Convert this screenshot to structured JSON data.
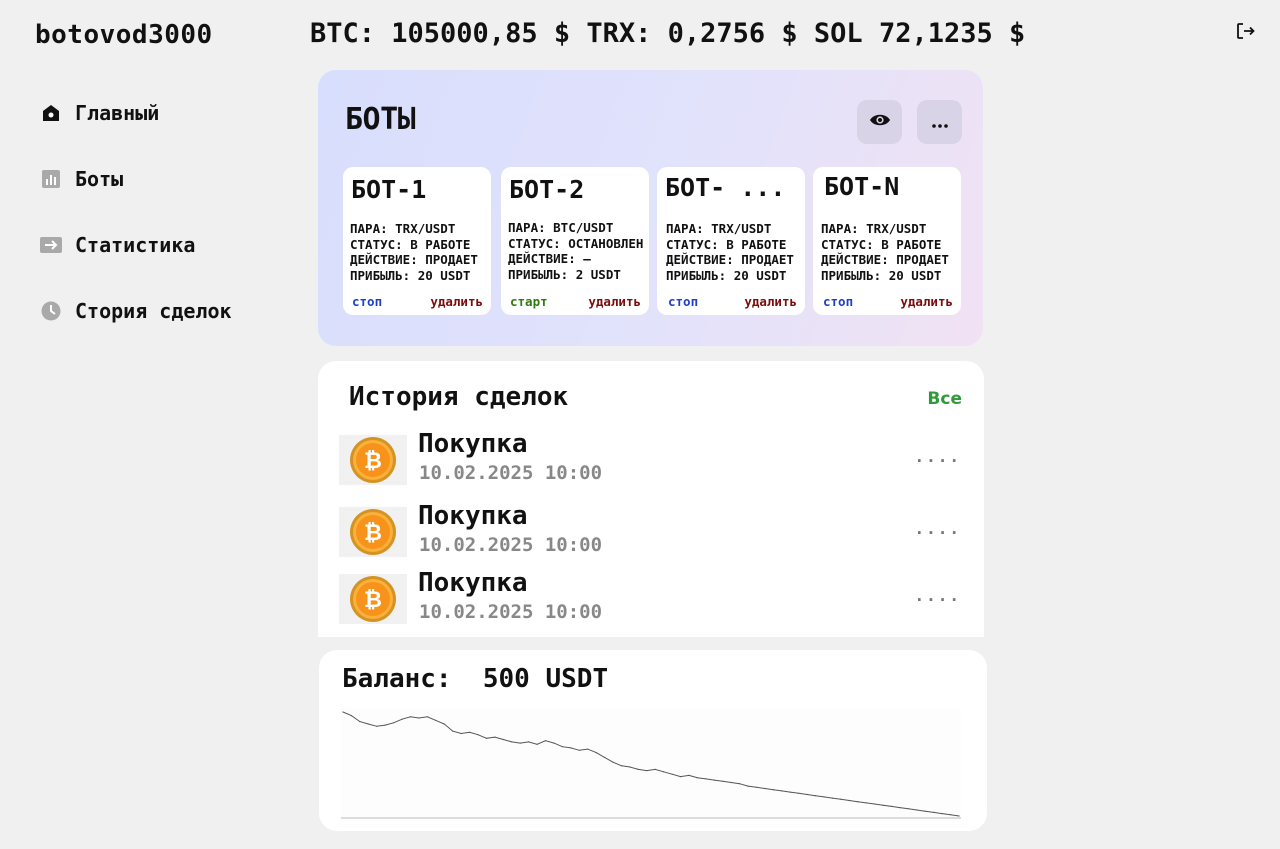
{
  "app": {
    "logo": "botovod3000"
  },
  "ticker": {
    "text": "BTC: 105000,85 $ TRX: 0,2756 $ SOL 72,1235 $"
  },
  "sidebar": {
    "items": [
      {
        "label": "Главный",
        "icon": "home-icon"
      },
      {
        "label": "Боты",
        "icon": "bar-chart-icon"
      },
      {
        "label": "Статистика",
        "icon": "arrow-right-icon"
      },
      {
        "label": "Стория сделок",
        "icon": "clock-icon"
      }
    ]
  },
  "bots": {
    "title": "БОТЫ",
    "cards": [
      {
        "name": "БОТ-1",
        "pair": "ПАРА: TRX/USDT",
        "status": "СТАТУС: В РАБОТЕ",
        "action": "ДЕЙСТВИЕ: ПРОДАЕТ",
        "profit": "ПРИБЫЛЬ: 20 USDT",
        "toggle": "стоп",
        "delete": "удалить"
      },
      {
        "name": "БОТ-2",
        "pair": "ПАРА: BTC/USDT",
        "status": "СТАТУС: ОСТАНОВЛЕН",
        "action": "ДЕЙСТВИЕ: –",
        "profit": "ПРИБЫЛЬ: 2 USDT",
        "toggle": "старт",
        "delete": "удалить"
      },
      {
        "name": "БОТ- ...",
        "pair": "ПАРА: TRX/USDT",
        "status": "СТАТУС: В РАБОТЕ",
        "action": "ДЕЙСТВИЕ: ПРОДАЕТ",
        "profit": "ПРИБЫЛЬ: 20 USDT",
        "toggle": "стоп",
        "delete": "удалить"
      },
      {
        "name": "БОТ-N",
        "pair": "ПАРА: TRX/USDT",
        "status": "СТАТУС: В РАБОТЕ",
        "action": "ДЕЙСТВИЕ: ПРОДАЕТ",
        "profit": "ПРИБЫЛЬ: 20 USDT",
        "toggle": "стоп",
        "delete": "удалить"
      }
    ]
  },
  "history": {
    "title": "История сделок",
    "all_label": "Все",
    "trades": [
      {
        "type": "Покупка",
        "date": "10.02.2025 10:00",
        "more": "...."
      },
      {
        "type": "Покупка",
        "date": "10.02.2025 10:00",
        "more": "...."
      },
      {
        "type": "Покупка",
        "date": "10.02.2025 10:00",
        "more": "...."
      }
    ]
  },
  "balance": {
    "label": "Баланс:  500 USDT"
  },
  "chart_data": {
    "type": "line",
    "title": "",
    "xlabel": "",
    "ylabel": "",
    "series": [
      {
        "values": [
          96,
          93,
          88,
          86,
          84,
          85,
          87,
          90,
          92,
          91,
          92,
          89,
          86,
          80,
          78,
          79,
          77,
          74,
          75,
          73,
          71,
          70,
          71,
          69,
          72,
          70,
          67,
          66,
          64,
          65,
          62,
          58,
          54,
          51,
          50,
          48,
          47,
          48,
          46,
          44,
          42,
          43,
          41,
          40,
          39,
          38,
          37,
          36,
          34,
          33,
          32,
          31,
          30,
          29,
          28,
          27,
          26,
          25,
          24,
          23,
          22,
          21,
          20,
          19,
          18,
          17,
          16,
          15,
          14,
          13,
          12,
          11,
          10,
          9
        ]
      }
    ],
    "grid": false
  },
  "colors": {
    "accent_green": "#2f9a3a",
    "stop_blue": "#1e3fc9",
    "start_green": "#2f7b10",
    "delete_red": "#7a0d0d",
    "bitcoin_orange": "#f7931a"
  }
}
